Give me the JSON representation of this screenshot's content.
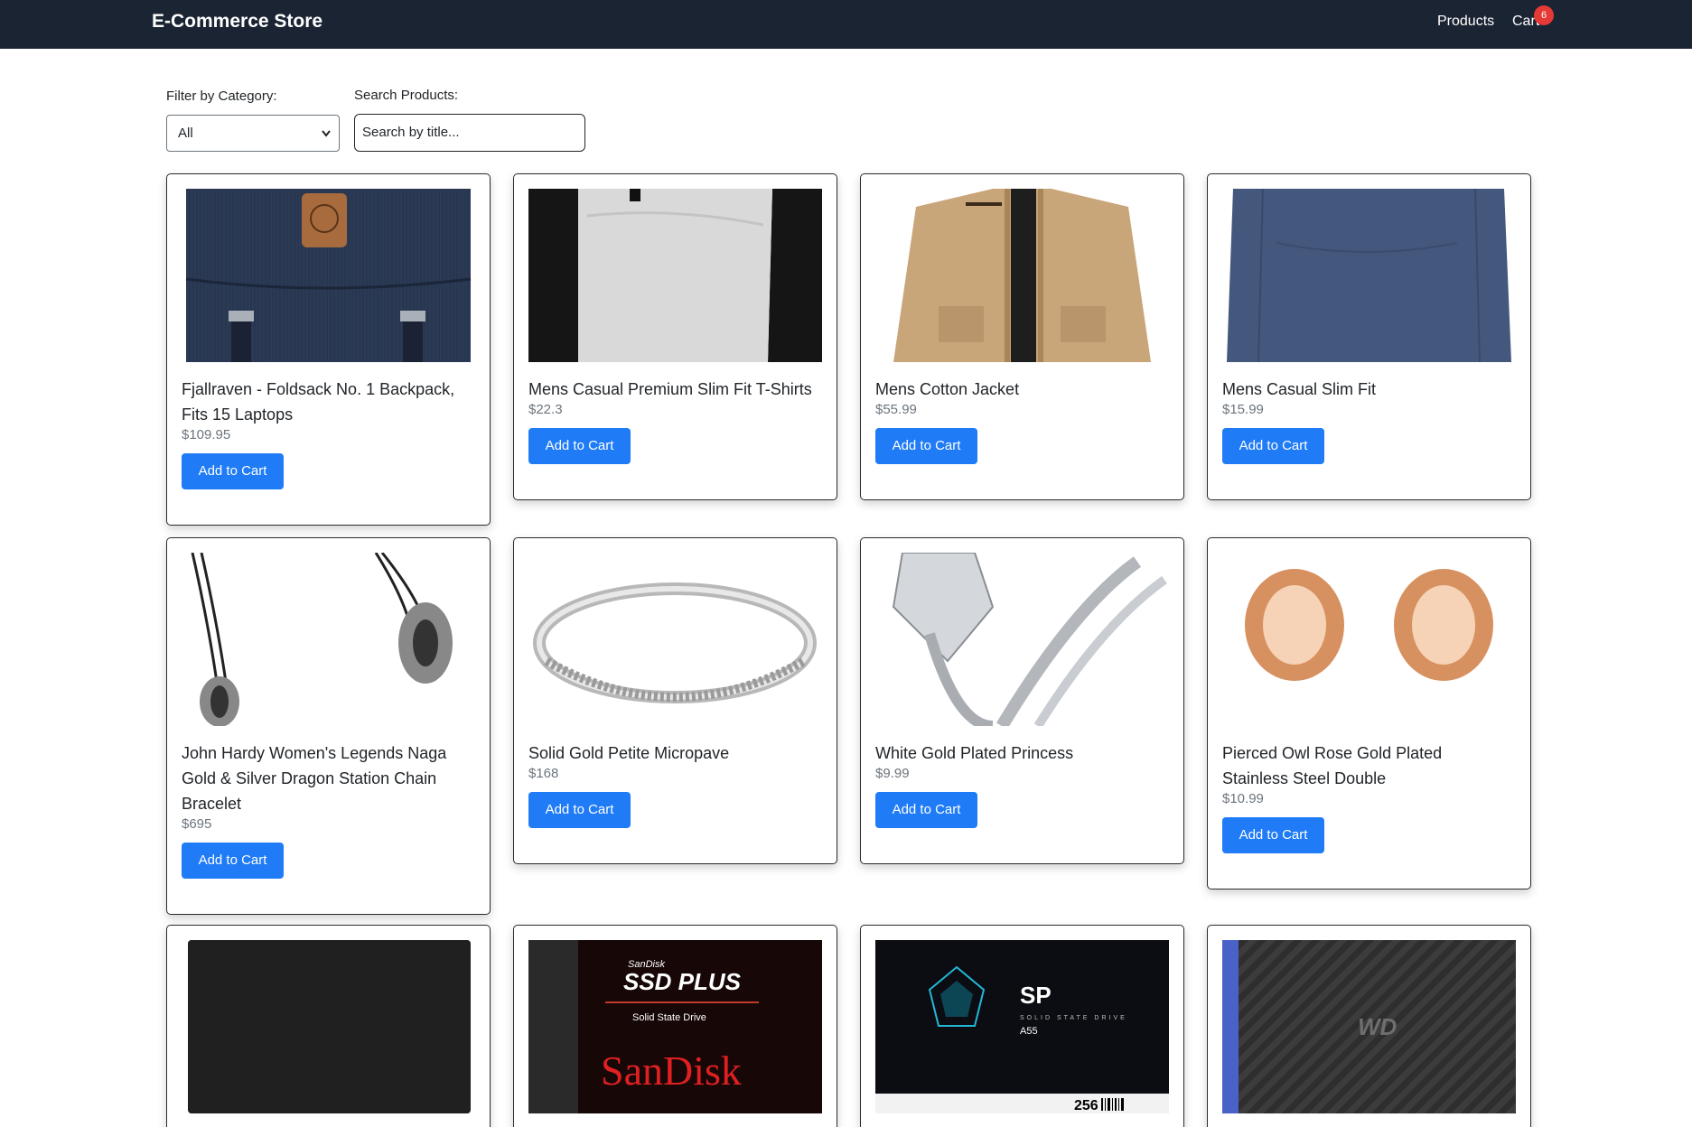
{
  "navbar": {
    "brand": "E-Commerce Store",
    "products_link": "Products",
    "cart_link": "Cart",
    "cart_count": "6",
    "bg_color": "#1b2433"
  },
  "filters": {
    "category_label": "Filter by Category:",
    "category_value": "All",
    "search_label": "Search Products:",
    "search_placeholder": "Search by title..."
  },
  "button_label": "Add to Cart",
  "accent_color": "#1f7bf6",
  "products": [
    {
      "title": "Fjallraven - Foldsack No. 1 Backpack, Fits 15 Laptops",
      "price": "$109.95",
      "image": "backpack"
    },
    {
      "title": "Mens Casual Premium Slim Fit T-Shirts",
      "price": "$22.3",
      "image": "tshirt"
    },
    {
      "title": "Mens Cotton Jacket",
      "price": "$55.99",
      "image": "jacket"
    },
    {
      "title": "Mens Casual Slim Fit",
      "price": "$15.99",
      "image": "longsleeve"
    },
    {
      "title": "John Hardy Women's Legends Naga Gold & Silver Dragon Station Chain Bracelet",
      "price": "$695",
      "image": "bracelet"
    },
    {
      "title": "Solid Gold Petite Micropave",
      "price": "$168",
      "image": "ring-band"
    },
    {
      "title": "White Gold Plated Princess",
      "price": "$9.99",
      "image": "ring-princess"
    },
    {
      "title": "Pierced Owl Rose Gold Plated Stainless Steel Double",
      "price": "$10.99",
      "image": "plugs"
    },
    {
      "title": "",
      "price": "",
      "image": "hdd-black"
    },
    {
      "title": "",
      "price": "",
      "image": "ssd-sandisk",
      "image_text": {
        "brand_small": "SanDisk",
        "product": "SSD PLUS",
        "sub": "Solid State Drive",
        "brand_big": "SanDisk"
      }
    },
    {
      "title": "",
      "price": "",
      "image": "ssd-sp",
      "image_text": {
        "logo": "SP",
        "sub": "SOLID STATE DRIVE",
        "model": "A55",
        "capacity": "256"
      }
    },
    {
      "title": "",
      "price": "",
      "image": "hdd-wd",
      "image_text": {
        "logo": "WD"
      }
    }
  ]
}
